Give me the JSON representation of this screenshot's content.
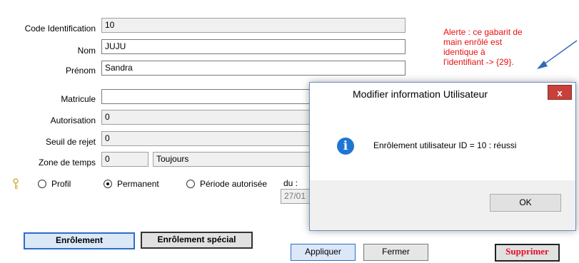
{
  "form": {
    "code_label": "Code Identification",
    "code_value": "10",
    "nom_label": "Nom",
    "nom_value": "JUJU",
    "prenom_label": "Prénom",
    "prenom_value": "Sandra",
    "matricule_label": "Matricule",
    "matricule_value": "",
    "autorisation_label": "Autorisation",
    "autorisation_value": "0",
    "seuil_label": "Seuil de rejet",
    "seuil_value": "0",
    "zone_label": "Zone de temps",
    "zone_value": "0",
    "zone_name": "Toujours",
    "radio_profil": "Profil",
    "radio_permanent": "Permanent",
    "radio_periode": "Période autorisée",
    "du_label": "du :",
    "date_value": "27/01"
  },
  "alert": {
    "line1": "Alerte : ce gabarit de",
    "line2": "main enrôlé est",
    "line3": "identique à",
    "line4": "l'identifiant -> {29}.",
    "color": "#e81010"
  },
  "buttons": {
    "enrolement": "Enrôlement",
    "enrolement_special": "Enrôlement spécial",
    "appliquer": "Appliquer",
    "fermer": "Fermer",
    "supprimer": "Supprimer"
  },
  "dialog": {
    "title": "Modifier information Utilisateur",
    "close": "x",
    "message": "Enrôlement utilisateur ID = 10 : réussi",
    "icon": "info-icon",
    "ok": "OK"
  },
  "icons": {
    "key": "key-icon",
    "arrow": "arrow-icon"
  }
}
